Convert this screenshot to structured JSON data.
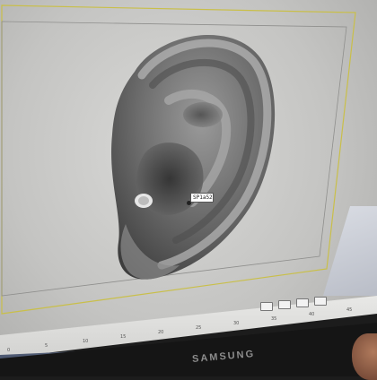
{
  "viewport": {
    "ear_marker_label": "SP1a52",
    "colors": {
      "background": "#c8c8c6",
      "border_outer": "#c9bf4a",
      "border_inner": "#8f8f8d",
      "model": "#7a7a7a"
    }
  },
  "timeline": {
    "tick_labels": [
      "0",
      "5",
      "10",
      "15",
      "20",
      "25",
      "30",
      "35",
      "40",
      "45"
    ]
  },
  "controls": {
    "icons": [
      "keyframe-icon",
      "play-icon",
      "loop-icon",
      "zoom-icon"
    ]
  },
  "dock": {
    "icons": [
      "finder-icon",
      "app-icon",
      "app-icon",
      "app-icon",
      "app-icon",
      "app-icon",
      "app-icon",
      "app-icon"
    ]
  },
  "monitor": {
    "brand": "SAMSUNG"
  }
}
